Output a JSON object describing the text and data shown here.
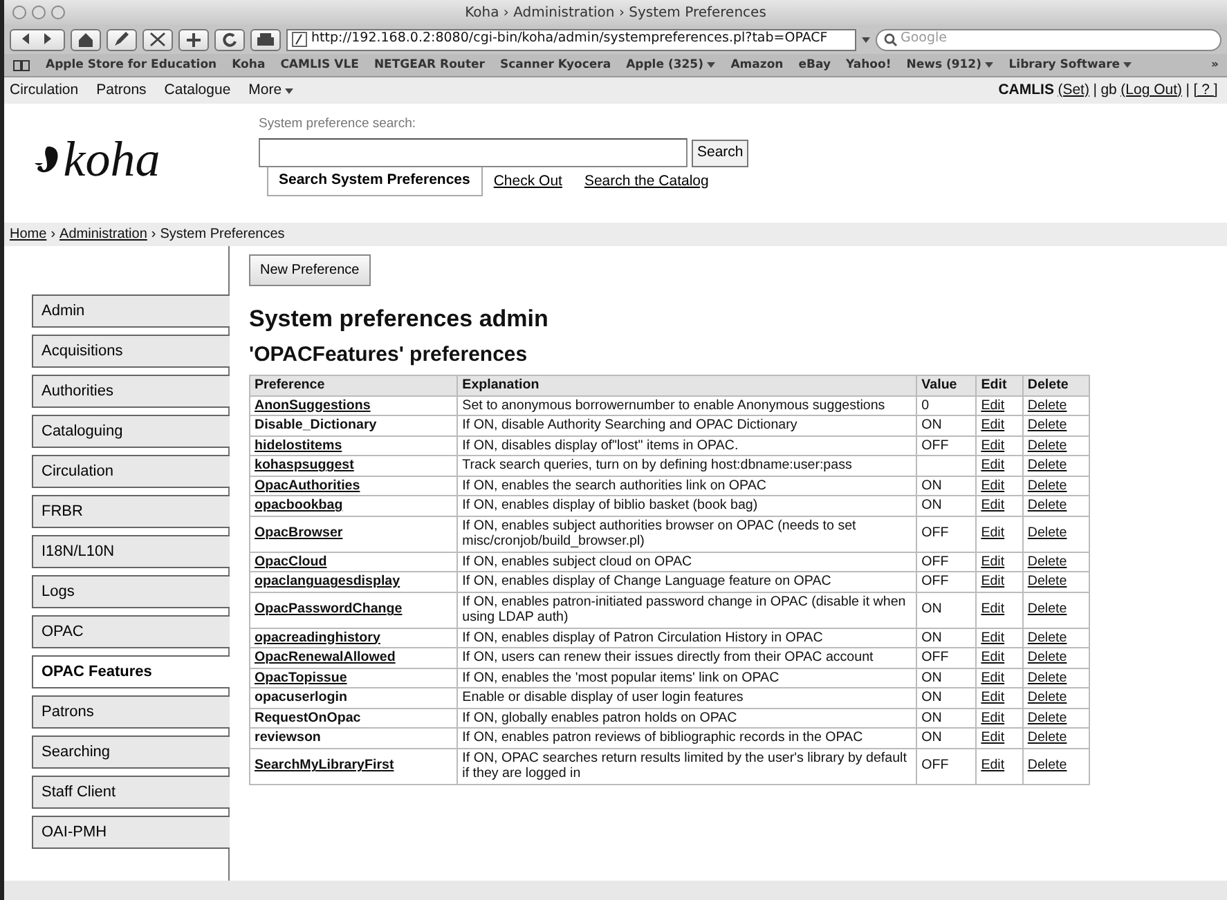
{
  "window": {
    "title": "Koha › Administration › System Preferences"
  },
  "browser": {
    "url": "http://192.168.0.2:8080/cgi-bin/koha/admin/systempreferences.pl?tab=OPACF",
    "search_placeholder": "Google",
    "bookmarks": [
      {
        "label": "Apple Store for Education",
        "menu": false
      },
      {
        "label": "Koha",
        "menu": false
      },
      {
        "label": "CAMLIS VLE",
        "menu": false
      },
      {
        "label": "NETGEAR Router",
        "menu": false
      },
      {
        "label": "Scanner Kyocera",
        "menu": false
      },
      {
        "label": "Apple (325)",
        "menu": true
      },
      {
        "label": "Amazon",
        "menu": false
      },
      {
        "label": "eBay",
        "menu": false
      },
      {
        "label": "Yahoo!",
        "menu": false
      },
      {
        "label": "News (912)",
        "menu": true
      },
      {
        "label": "Library Software",
        "menu": true
      }
    ],
    "overflow": "»"
  },
  "koha_nav": [
    {
      "label": "Circulation",
      "menu": false
    },
    {
      "label": "Patrons",
      "menu": false
    },
    {
      "label": "Catalogue",
      "menu": false
    },
    {
      "label": "More",
      "menu": true
    }
  ],
  "user_bar": [
    {
      "text": "CAMLIS",
      "kind": "bold"
    },
    {
      "text": "(Set)",
      "kind": "link"
    },
    {
      "text": "|",
      "kind": "text"
    },
    {
      "text": "gb",
      "kind": "text"
    },
    {
      "text": "(Log Out)",
      "kind": "link"
    },
    {
      "text": "|",
      "kind": "text"
    },
    {
      "text": "[ ? ]",
      "kind": "link"
    }
  ],
  "logo": {
    "text": "koha"
  },
  "search": {
    "label": "System preference search:",
    "button": "Search",
    "tabs": [
      {
        "label": "Search System Preferences",
        "selected": true
      },
      {
        "label": "Check Out",
        "selected": false
      },
      {
        "label": "Search the Catalog",
        "selected": false
      }
    ]
  },
  "breadcrumb": {
    "separator": "›",
    "items": [
      {
        "label": "Home",
        "link": true
      },
      {
        "label": "Administration",
        "link": true
      },
      {
        "label": "System Preferences",
        "link": false
      }
    ]
  },
  "sidebar": {
    "items": [
      {
        "label": "Admin",
        "selected": false
      },
      {
        "label": "Acquisitions",
        "selected": false
      },
      {
        "label": "Authorities",
        "selected": false
      },
      {
        "label": "Cataloguing",
        "selected": false
      },
      {
        "label": "Circulation",
        "selected": false
      },
      {
        "label": "FRBR",
        "selected": false
      },
      {
        "label": "I18N/L10N",
        "selected": false
      },
      {
        "label": "Logs",
        "selected": false
      },
      {
        "label": "OPAC",
        "selected": false
      },
      {
        "label": "OPAC Features",
        "selected": true
      },
      {
        "label": "Patrons",
        "selected": false
      },
      {
        "label": "Searching",
        "selected": false
      },
      {
        "label": "Staff Client",
        "selected": false
      },
      {
        "label": "OAI-PMH",
        "selected": false
      }
    ]
  },
  "new_button": "New Preference",
  "heading": "System preferences admin",
  "subheading": "'OPACFeatures' preferences",
  "table": {
    "columns": [
      "Preference",
      "Explanation",
      "Value",
      "Edit",
      "Delete"
    ],
    "rows": [
      {
        "preference": "AnonSuggestions",
        "linked": true,
        "explanation": "Set to anonymous borrowernumber to enable Anonymous suggestions",
        "value": "0",
        "edit": "Edit",
        "delete": "Delete"
      },
      {
        "preference": "Disable_Dictionary",
        "linked": false,
        "explanation": "If ON, disable Authority Searching and OPAC Dictionary",
        "value": "ON",
        "edit": "Edit",
        "delete": "Delete"
      },
      {
        "preference": "hidelostitems",
        "linked": true,
        "explanation": "If ON, disables display of\"lost\" items in OPAC.",
        "value": "OFF",
        "edit": "Edit",
        "delete": "Delete"
      },
      {
        "preference": "kohaspsuggest",
        "linked": true,
        "explanation": "Track search queries, turn on by defining host:dbname:user:pass",
        "edit": "Edit",
        "delete": "Delete"
      },
      {
        "preference": "OpacAuthorities",
        "linked": true,
        "explanation": "If ON, enables the search authorities link on OPAC",
        "value": "ON",
        "edit": "Edit",
        "delete": "Delete"
      },
      {
        "preference": "opacbookbag",
        "linked": true,
        "explanation": "If ON, enables display of biblio basket (book bag)",
        "value": "ON",
        "edit": "Edit",
        "delete": "Delete"
      },
      {
        "preference": "OpacBrowser",
        "linked": true,
        "explanation": "If ON, enables subject authorities browser on OPAC (needs to set misc/cronjob/build_browser.pl)",
        "value": "OFF",
        "edit": "Edit",
        "delete": "Delete"
      },
      {
        "preference": "OpacCloud",
        "linked": true,
        "explanation": "If ON, enables subject cloud on OPAC",
        "value": "OFF",
        "edit": "Edit",
        "delete": "Delete"
      },
      {
        "preference": "opaclanguagesdisplay",
        "linked": true,
        "explanation": "If ON, enables display of Change Language feature on OPAC",
        "value": "OFF",
        "edit": "Edit",
        "delete": "Delete"
      },
      {
        "preference": "OpacPasswordChange",
        "linked": true,
        "explanation": "If ON, enables patron-initiated password change in OPAC (disable it when using LDAP auth)",
        "value": "ON",
        "edit": "Edit",
        "delete": "Delete"
      },
      {
        "preference": "opacreadinghistory",
        "linked": true,
        "explanation": "If ON, enables display of Patron Circulation History in OPAC",
        "value": "ON",
        "edit": "Edit",
        "delete": "Delete"
      },
      {
        "preference": "OpacRenewalAllowed",
        "linked": true,
        "explanation": "If ON, users can renew their issues directly from their OPAC account",
        "value": "OFF",
        "edit": "Edit",
        "delete": "Delete"
      },
      {
        "preference": "OpacTopissue",
        "linked": true,
        "explanation": "If ON, enables the 'most popular items' link on OPAC",
        "value": "ON",
        "edit": "Edit",
        "delete": "Delete"
      },
      {
        "preference": "opacuserlogin",
        "linked": false,
        "explanation": "Enable or disable display of user login features",
        "value": "ON",
        "edit": "Edit",
        "delete": "Delete"
      },
      {
        "preference": "RequestOnOpac",
        "linked": false,
        "explanation": "If ON, globally enables patron holds on OPAC",
        "value": "ON",
        "edit": "Edit",
        "delete": "Delete"
      },
      {
        "preference": "reviewson",
        "linked": false,
        "explanation": "If ON, enables patron reviews of bibliographic records in the OPAC",
        "value": "ON",
        "edit": "Edit",
        "delete": "Delete"
      },
      {
        "preference": "SearchMyLibraryFirst",
        "linked": true,
        "explanation": "If ON, OPAC searches return results limited by the user's library by default if they are logged in",
        "value": "OFF",
        "edit": "Edit",
        "delete": "Delete"
      }
    ]
  }
}
